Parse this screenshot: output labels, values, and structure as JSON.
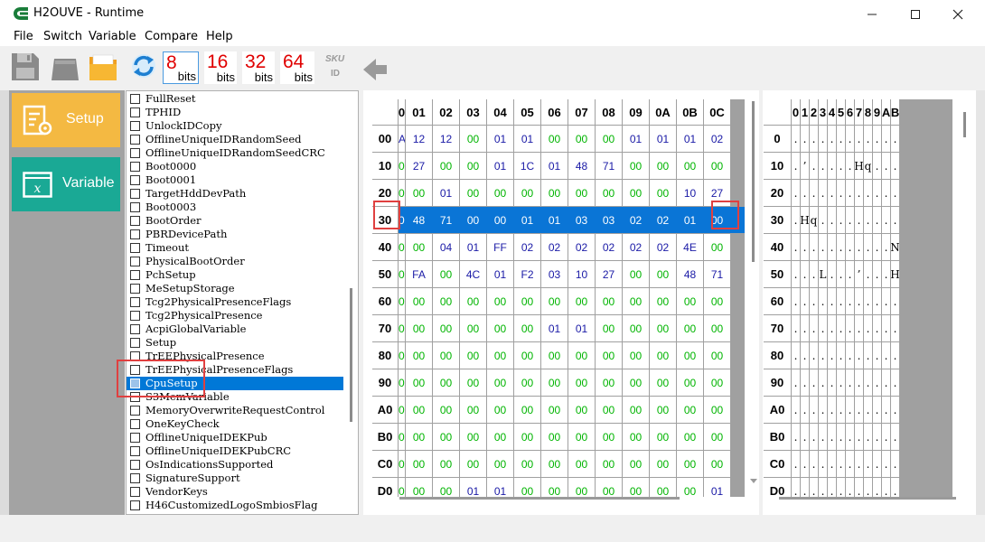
{
  "window": {
    "title": "H2OUVE - Runtime"
  },
  "menu": [
    "File",
    "Switch",
    "Variable",
    "Compare",
    "Help"
  ],
  "toolbar": {
    "bits": [
      {
        "num": "8",
        "label": "bits"
      },
      {
        "num": "16",
        "label": "bits"
      },
      {
        "num": "32",
        "label": "bits"
      },
      {
        "num": "64",
        "label": "bits"
      }
    ],
    "sku_label": "SKU",
    "id_label": "ID"
  },
  "nav": {
    "setup": "Setup",
    "variable": "Variable"
  },
  "variables": {
    "items": [
      "FullReset",
      "TPHID",
      "UnlockIDCopy",
      "OfflineUniqueIDRandomSeed",
      "OfflineUniqueIDRandomSeedCRC",
      "Boot0000",
      "Boot0001",
      "TargetHddDevPath",
      "Boot0003",
      "BootOrder",
      "PBRDevicePath",
      "Timeout",
      "PhysicalBootOrder",
      "PchSetup",
      "MeSetupStorage",
      "Tcg2PhysicalPresenceFlags",
      "Tcg2PhysicalPresence",
      "AcpiGlobalVariable",
      "Setup",
      "TrEEPhysicalPresence",
      "TrEEPhysicalPresenceFlags",
      "CpuSetup",
      "S3MemVariable",
      "MemoryOverwriteRequestControl",
      "OneKeyCheck",
      "OfflineUniqueIDEKPub",
      "OfflineUniqueIDEKPubCRC",
      "OsIndicationsSupported",
      "SignatureSupport",
      "VendorKeys",
      "H46CustomizedLogoSmbiosFlag"
    ],
    "selected_index": 21
  },
  "hex": {
    "columns": [
      "0",
      "01",
      "02",
      "03",
      "04",
      "05",
      "06",
      "07",
      "08",
      "09",
      "0A",
      "0B",
      "0C"
    ],
    "rows": [
      {
        "addr": "00",
        "cells": [
          "A",
          "12",
          "12",
          "00",
          "01",
          "01",
          "00",
          "00",
          "00",
          "01",
          "01",
          "01",
          "02"
        ]
      },
      {
        "addr": "10",
        "cells": [
          "0",
          "27",
          "00",
          "00",
          "01",
          "1C",
          "01",
          "48",
          "71",
          "00",
          "00",
          "00",
          "00"
        ]
      },
      {
        "addr": "20",
        "cells": [
          "0",
          "00",
          "01",
          "00",
          "00",
          "00",
          "00",
          "00",
          "00",
          "00",
          "00",
          "10",
          "27"
        ]
      },
      {
        "addr": "30",
        "cells": [
          "0",
          "48",
          "71",
          "00",
          "00",
          "01",
          "01",
          "03",
          "03",
          "02",
          "02",
          "01",
          "00"
        ]
      },
      {
        "addr": "40",
        "cells": [
          "0",
          "00",
          "04",
          "01",
          "FF",
          "02",
          "02",
          "02",
          "02",
          "02",
          "02",
          "4E",
          "00"
        ]
      },
      {
        "addr": "50",
        "cells": [
          "0",
          "FA",
          "00",
          "4C",
          "01",
          "F2",
          "03",
          "10",
          "27",
          "00",
          "00",
          "48",
          "71"
        ]
      },
      {
        "addr": "60",
        "cells": [
          "0",
          "00",
          "00",
          "00",
          "00",
          "00",
          "00",
          "00",
          "00",
          "00",
          "00",
          "00",
          "00"
        ]
      },
      {
        "addr": "70",
        "cells": [
          "0",
          "00",
          "00",
          "00",
          "00",
          "00",
          "01",
          "01",
          "00",
          "00",
          "00",
          "00",
          "00"
        ]
      },
      {
        "addr": "80",
        "cells": [
          "0",
          "00",
          "00",
          "00",
          "00",
          "00",
          "00",
          "00",
          "00",
          "00",
          "00",
          "00",
          "00"
        ]
      },
      {
        "addr": "90",
        "cells": [
          "0",
          "00",
          "00",
          "00",
          "00",
          "00",
          "00",
          "00",
          "00",
          "00",
          "00",
          "00",
          "00"
        ]
      },
      {
        "addr": "A0",
        "cells": [
          "0",
          "00",
          "00",
          "00",
          "00",
          "00",
          "00",
          "00",
          "00",
          "00",
          "00",
          "00",
          "00"
        ]
      },
      {
        "addr": "B0",
        "cells": [
          "0",
          "00",
          "00",
          "00",
          "00",
          "00",
          "00",
          "00",
          "00",
          "00",
          "00",
          "00",
          "00"
        ]
      },
      {
        "addr": "C0",
        "cells": [
          "0",
          "00",
          "00",
          "00",
          "00",
          "00",
          "00",
          "00",
          "00",
          "00",
          "00",
          "00",
          "00"
        ]
      },
      {
        "addr": "D0",
        "cells": [
          "0",
          "00",
          "00",
          "01",
          "01",
          "00",
          "00",
          "00",
          "00",
          "00",
          "00",
          "00",
          "01"
        ]
      }
    ],
    "selected_row": 3
  },
  "ascii": {
    "columns": [
      "0",
      "1",
      "2",
      "3",
      "4",
      "5",
      "6",
      "7",
      "8",
      "9",
      "A",
      "B"
    ],
    "rows": [
      {
        "addr": "0",
        "cells": [
          ".",
          ".",
          ".",
          ".",
          ".",
          ".",
          ".",
          ".",
          ".",
          ".",
          ".",
          "."
        ]
      },
      {
        "addr": "10",
        "cells": [
          ".",
          "’",
          ".",
          ".",
          ".",
          ".",
          ".",
          "H",
          "q",
          ".",
          ".",
          "."
        ]
      },
      {
        "addr": "20",
        "cells": [
          ".",
          ".",
          ".",
          ".",
          ".",
          ".",
          ".",
          ".",
          ".",
          ".",
          ".",
          "."
        ]
      },
      {
        "addr": "30",
        "cells": [
          ".",
          "H",
          "q",
          ".",
          ".",
          ".",
          ".",
          ".",
          ".",
          ".",
          ".",
          "."
        ]
      },
      {
        "addr": "40",
        "cells": [
          ".",
          ".",
          ".",
          ".",
          ".",
          ".",
          ".",
          ".",
          ".",
          ".",
          ".",
          "N"
        ]
      },
      {
        "addr": "50",
        "cells": [
          ".",
          ".",
          ".",
          "L",
          ".",
          ".",
          ".",
          "’",
          ".",
          ".",
          ".",
          "H"
        ]
      },
      {
        "addr": "60",
        "cells": [
          ".",
          ".",
          ".",
          ".",
          ".",
          ".",
          ".",
          ".",
          ".",
          ".",
          ".",
          "."
        ]
      },
      {
        "addr": "70",
        "cells": [
          ".",
          ".",
          ".",
          ".",
          ".",
          ".",
          ".",
          ".",
          ".",
          ".",
          ".",
          "."
        ]
      },
      {
        "addr": "80",
        "cells": [
          ".",
          ".",
          ".",
          ".",
          ".",
          ".",
          ".",
          ".",
          ".",
          ".",
          ".",
          "."
        ]
      },
      {
        "addr": "90",
        "cells": [
          ".",
          ".",
          ".",
          ".",
          ".",
          ".",
          ".",
          ".",
          ".",
          ".",
          ".",
          "."
        ]
      },
      {
        "addr": "A0",
        "cells": [
          ".",
          ".",
          ".",
          ".",
          ".",
          ".",
          ".",
          ".",
          ".",
          ".",
          ".",
          "."
        ]
      },
      {
        "addr": "B0",
        "cells": [
          ".",
          ".",
          ".",
          ".",
          ".",
          ".",
          ".",
          ".",
          ".",
          ".",
          ".",
          "."
        ]
      },
      {
        "addr": "C0",
        "cells": [
          ".",
          ".",
          ".",
          ".",
          ".",
          ".",
          ".",
          ".",
          ".",
          ".",
          ".",
          "."
        ]
      },
      {
        "addr": "D0",
        "cells": [
          ".",
          ".",
          ".",
          ".",
          ".",
          ".",
          ".",
          ".",
          ".",
          ".",
          ".",
          "."
        ]
      }
    ]
  },
  "colors": {
    "zero": "#00b400",
    "nonzero": "#1a1aa6",
    "selection": "#0a75d6",
    "highlight": "#e04040",
    "bits_number": "#e00000",
    "setup_btn": "#f4b942",
    "variable_btn": "#1aa995"
  }
}
